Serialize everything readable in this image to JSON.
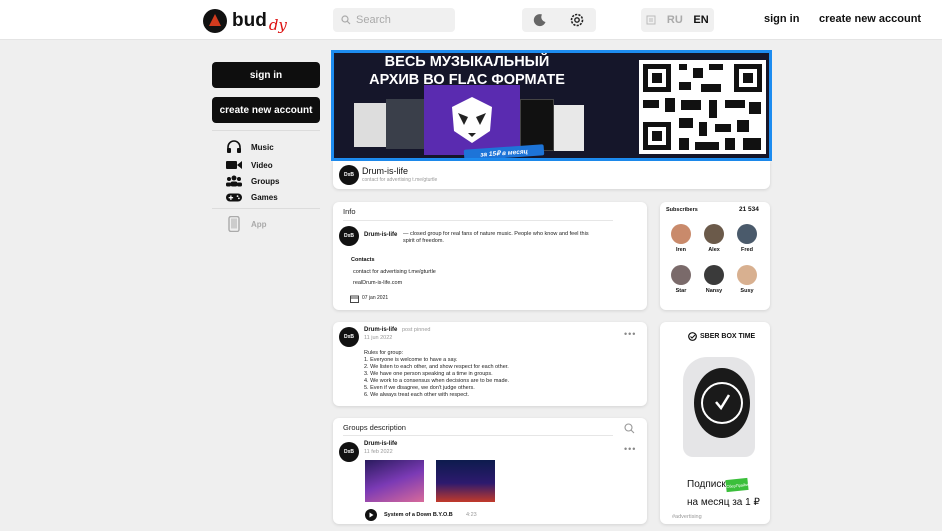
{
  "header": {
    "logo_main": "bud",
    "logo_sub": "dy",
    "search_placeholder": "Search",
    "lang_ru": "RU",
    "lang_en": "EN",
    "sign_in": "sign in",
    "create_account": "create new account"
  },
  "sidebar": {
    "sign_in": "sign in",
    "create_account": "create new account",
    "items": [
      {
        "label": "Music",
        "icon": "headphones-icon"
      },
      {
        "label": "Video",
        "icon": "video-camera-icon"
      },
      {
        "label": "Groups",
        "icon": "groups-icon"
      },
      {
        "label": "Games",
        "icon": "gamepad-icon"
      }
    ],
    "app_label": "App"
  },
  "banner": {
    "line1": "ВЕСЬ МУЗЫКАЛЬНЫЙ",
    "line2": "АРХИВ ВО FLAC ФОРМАТЕ",
    "price": "за 15₽ в месяц"
  },
  "group": {
    "avatar": "DxB",
    "name": "Drum-is-life",
    "subtitle": "contact for advertising t.me/gturtle"
  },
  "info": {
    "title": "Info",
    "name": "Drum-is-life",
    "description_line1": "— closed group for real fans of nature music. People who know and feel this",
    "description_line2": "spirit of freedom.",
    "contacts_title": "Contacts",
    "contact_1": "contact for advertising t.me/gturtle",
    "contact_2": "realDrum-is-life.com",
    "date": "07 jan 2021"
  },
  "subscribers": {
    "title": "Subscribers",
    "count": "21 534",
    "people": [
      {
        "name": "Iren",
        "color": "#c98a6b"
      },
      {
        "name": "Alex",
        "color": "#6b5a4a"
      },
      {
        "name": "Fred",
        "color": "#4a5a6b"
      },
      {
        "name": "Star",
        "color": "#7a6a6a"
      },
      {
        "name": "Nansy",
        "color": "#3a3a3a"
      },
      {
        "name": "Susy",
        "color": "#d8b090"
      }
    ]
  },
  "post": {
    "name": "Drum-is-life",
    "pinned": "post pinned",
    "date": "11 jun 2022",
    "lines": [
      "Rules for group:",
      "1. Everyone is welcome to have a say.",
      "2. We listen to each other, and show respect for each other.",
      "3. We have one person speaking at a time in groups.",
      "4. We work to a consensus when decisions are to be made.",
      "5. Even if we disagree, we don't judge others.",
      "6. We always treat each other with respect."
    ]
  },
  "ad": {
    "brand": "SBER BOX TIME",
    "line1": "Подписка",
    "sticker": "СберПрайм",
    "line2": "на месяц за 1 ₽",
    "tag": "#advertising"
  },
  "groups_desc": {
    "title": "Groups description",
    "name": "Drum-is-life",
    "date": "11 feb 2022",
    "track": "System of a Down B.Y.O.B",
    "duration": "4:23"
  },
  "colors": {
    "accent_blue": "#1d8cf0",
    "logo_red": "#d11111"
  }
}
